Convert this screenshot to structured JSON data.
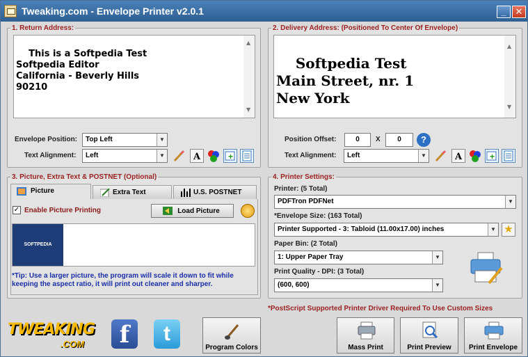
{
  "window": {
    "title": "Tweaking.com - Envelope Printer v2.0.1"
  },
  "return_address": {
    "legend": "1. Return Address:",
    "text": "This is a Softpedia Test\nSoftpedia Editor\nCalifornia - Beverly Hills\n90210",
    "envelope_position_label": "Envelope Position:",
    "envelope_position_value": "Top Left",
    "text_alignment_label": "Text Alignment:",
    "text_alignment_value": "Left"
  },
  "delivery_address": {
    "legend": "2. Delivery Address: (Positioned To Center Of Envelope)",
    "text": "Softpedia Test\nMain Street, nr. 1\nNew York",
    "position_offset_label": "Position Offset:",
    "offset_x": "0",
    "offset_sep": "X",
    "offset_y": "0",
    "text_alignment_label": "Text Alignment:",
    "text_alignment_value": "Left"
  },
  "picture": {
    "legend": "3. Picture, Extra Text & POSTNET (Optional)",
    "tabs": [
      "Picture",
      "Extra Text",
      "U.S. POSTNET"
    ],
    "enable_label": "Enable Picture Printing",
    "load_button": "Load Picture",
    "preview_logo": "SOFTPEDIA",
    "tip": "*Tip: Use a larger picture, the program will scale it down to fit while keeping the aspect ratio, it will print out cleaner and sharper."
  },
  "printer": {
    "legend": "4. Printer Settings:",
    "printer_label": "Printer: (5 Total)",
    "printer_value": "PDFTron PDFNet",
    "envelope_size_label": "*Envelope Size: (163 Total)",
    "envelope_size_value": "Printer Supported - 3: Tabloid (11.00x17.00) inches",
    "paper_bin_label": "Paper Bin: (2 Total)",
    "paper_bin_value": "1: Upper Paper Tray",
    "quality_label": "Print Quality - DPI: (3 Total)",
    "quality_value": "(600, 600)",
    "footnote": "*PostScript Supported Printer Driver Required To Use Custom Sizes"
  },
  "bottom": {
    "logo_text": "TWEAKING",
    "logo_sub": ".COM",
    "program_colors": "Program Colors",
    "mass_print": "Mass Print",
    "print_preview": "Print Preview",
    "print_envelope": "Print Envelope"
  },
  "colors": {
    "legend": "#9b2121",
    "tip": "#1a2fa8",
    "titlebar": "#3568a3"
  }
}
